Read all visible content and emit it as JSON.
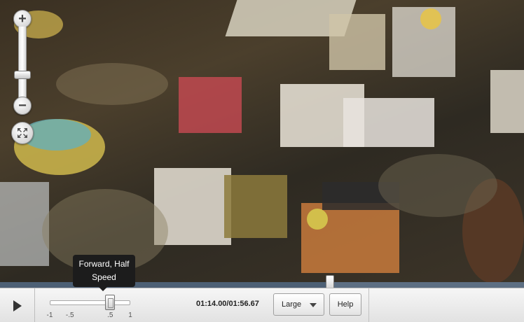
{
  "player": {
    "video_description_icon": "carnival-panorama-icon",
    "zoom": {
      "zoom_in_icon": "plus-icon",
      "zoom_out_icon": "minus-icon",
      "fit_icon": "fit-to-screen-icon",
      "zoom_in_label": "+",
      "zoom_out_label": "−"
    },
    "playback": {
      "progress_fraction": 0.63,
      "current_time": "01:14.00",
      "total_time": "01:56.67",
      "time_display": "01:14.00/01:56.67",
      "play_icon": "play-icon"
    },
    "speed": {
      "ticks": [
        "-1",
        "-.5",
        ".5",
        "1"
      ],
      "selected_value": 0.5,
      "tooltip_line1": "Forward, Half",
      "tooltip_line2": "Speed"
    },
    "size_select": {
      "selected": "Large",
      "caret_icon": "chevron-down-icon"
    },
    "help_label": "Help"
  },
  "colors": {
    "progress_track": "#5d6f83",
    "tooltip_bg": "#1c1c1c"
  }
}
